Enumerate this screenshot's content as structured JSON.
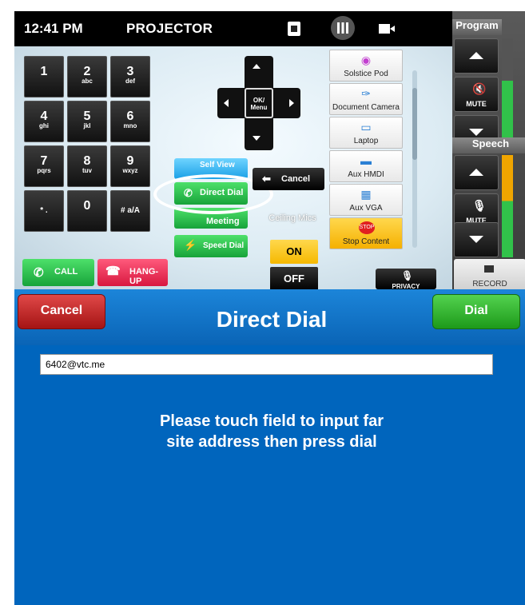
{
  "topbar": {
    "time": "12:41 PM",
    "title": "PROJECTOR"
  },
  "keypad": [
    {
      "digit": "1",
      "letters": ""
    },
    {
      "digit": "2",
      "letters": "abc"
    },
    {
      "digit": "3",
      "letters": "def"
    },
    {
      "digit": "4",
      "letters": "ghi"
    },
    {
      "digit": "5",
      "letters": "jkl"
    },
    {
      "digit": "6",
      "letters": "mno"
    },
    {
      "digit": "7",
      "letters": "pqrs"
    },
    {
      "digit": "8",
      "letters": "tuv"
    },
    {
      "digit": "9",
      "letters": "wxyz"
    },
    {
      "digit": "* .",
      "letters": ""
    },
    {
      "digit": "0",
      "letters": ""
    },
    {
      "digit": "# a/A",
      "letters": ""
    }
  ],
  "dpad": {
    "center": "OK/ Menu"
  },
  "actions": {
    "self_view": "Self View",
    "direct_dial": "Direct Dial",
    "meeting": "Meeting",
    "speed_dial": "Speed Dial",
    "cancel": "Cancel",
    "call": "CALL",
    "hangup": "HANG-UP"
  },
  "ceiling_mics": {
    "label": "Ceiling Mics",
    "on": "ON",
    "off": "OFF"
  },
  "sources": [
    "Solstice Pod",
    "Document Camera",
    "Laptop",
    "Aux HMDI",
    "Aux VGA",
    "Stop Content"
  ],
  "privacy": "PRIVACY",
  "right": {
    "program": "Program",
    "speech": "Speech",
    "mute": "MUTE",
    "record": "RECORD"
  },
  "dialog": {
    "cancel": "Cancel",
    "title": "Direct Dial",
    "dial": "Dial",
    "address_value": "6402@vtc.me",
    "instruction_line1": "Please touch field to input far",
    "instruction_line2": "site address then press dial"
  },
  "colors": {
    "dialog_bg": "#0065bd",
    "call_green": "#17a33a",
    "hangup_red": "#d8173f",
    "stop_orange": "#ffb400"
  }
}
